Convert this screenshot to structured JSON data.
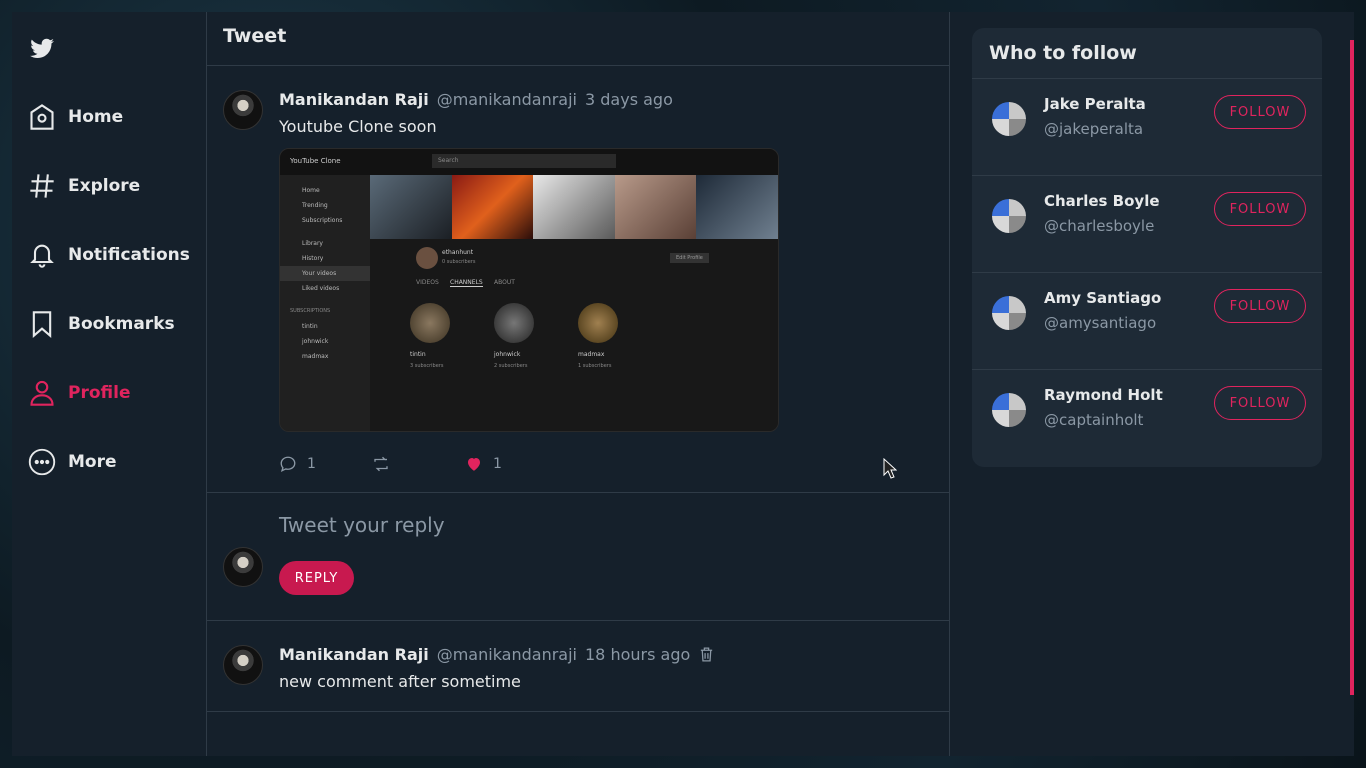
{
  "nav": {
    "items": [
      {
        "label": "Home",
        "icon": "home-icon"
      },
      {
        "label": "Explore",
        "icon": "hashtag-icon"
      },
      {
        "label": "Notifications",
        "icon": "bell-icon"
      },
      {
        "label": "Bookmarks",
        "icon": "bookmark-icon"
      },
      {
        "label": "Profile",
        "icon": "user-icon",
        "active": true
      },
      {
        "label": "More",
        "icon": "more-icon"
      }
    ]
  },
  "colors": {
    "accent": "#e0245e",
    "background": "#15202b",
    "muted": "#8b98a5"
  },
  "header": {
    "title": "Tweet"
  },
  "tweet": {
    "name": "Manikandan Raji",
    "handle": "@manikandanraji",
    "time": "3 days ago",
    "text": "Youtube Clone soon",
    "comments": "1",
    "likes": "1",
    "media": {
      "app_title": "YouTube Clone",
      "search": "Search",
      "sidebar": [
        "Home",
        "Trending",
        "Subscriptions",
        "Library",
        "History",
        "Your videos",
        "Liked videos"
      ],
      "subs_header": "SUBSCRIPTIONS",
      "subs": [
        "tintin",
        "johnwick",
        "madmax"
      ],
      "channel": "ethanhunt",
      "channel_subs": "0 subscribers",
      "edit": "Edit Profile",
      "tabs": [
        "VIDEOS",
        "CHANNELS",
        "ABOUT"
      ],
      "cards": [
        {
          "name": "tintin",
          "subs": "3 subscribers"
        },
        {
          "name": "johnwick",
          "subs": "2 subscribers"
        },
        {
          "name": "madmax",
          "subs": "1 subscribers"
        }
      ]
    }
  },
  "reply": {
    "placeholder": "Tweet your reply",
    "button": "REPLY"
  },
  "comment": {
    "name": "Manikandan Raji",
    "handle": "@manikandanraji",
    "time": "18 hours ago",
    "text": "new comment after sometime"
  },
  "who_to_follow": {
    "title": "Who to follow",
    "button": "FOLLOW",
    "users": [
      {
        "name": "Jake Peralta",
        "handle": "@jakeperalta"
      },
      {
        "name": "Charles Boyle",
        "handle": "@charlesboyle"
      },
      {
        "name": "Amy Santiago",
        "handle": "@amysantiago"
      },
      {
        "name": "Raymond Holt",
        "handle": "@captainholt"
      }
    ]
  }
}
